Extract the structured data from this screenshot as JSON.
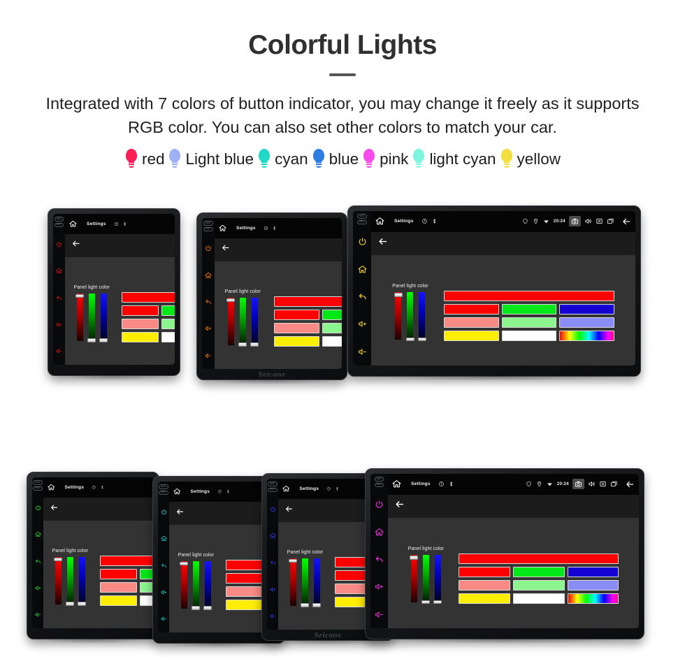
{
  "header": {
    "title": "Colorful Lights",
    "subtitle": "Integrated with 7 colors of button indicator, you may change it freely as it supports RGB color. You can also set other colors to match your car."
  },
  "legend": {
    "items": [
      {
        "label": "red",
        "color": "#fa1d56"
      },
      {
        "label": "Light blue",
        "color": "#9fb0f5"
      },
      {
        "label": "cyan",
        "color": "#24d8c8"
      },
      {
        "label": "blue",
        "color": "#2e7de0"
      },
      {
        "label": "pink",
        "color": "#f94cec"
      },
      {
        "label": "light cyan",
        "color": "#7df5de"
      },
      {
        "label": "yellow",
        "color": "#f2de3e"
      }
    ]
  },
  "device_ui": {
    "status_bar": {
      "home_icon": "home-icon",
      "title": "Settings",
      "mini_icons": [
        "clock-icon",
        "bluetooth-icon"
      ],
      "tray_icons": [
        "shield-icon",
        "location-pin-icon",
        "wifi-icon"
      ],
      "clock": "20:24",
      "action_icons": [
        "camera-icon",
        "volume-icon",
        "close-box-icon",
        "recents-icon",
        "back-arrow-icon"
      ]
    },
    "action_bar": {
      "back_icon": "back-arrow-icon"
    },
    "panel": {
      "label": "Panel light color",
      "sliders": [
        {
          "name": "red",
          "channel": "R",
          "value": 255,
          "thumb": "top"
        },
        {
          "name": "green",
          "channel": "G",
          "value": 0,
          "thumb": "bottom"
        },
        {
          "name": "blue",
          "channel": "B",
          "value": 0,
          "thumb": "bottom"
        }
      ],
      "preview_color": "#ff0000",
      "swatch_rows": [
        [
          "#ff0000",
          "#00e817",
          "#1400d2"
        ],
        [
          "#fa8a85",
          "#8df58d",
          "#8a8df5"
        ],
        [
          "#ffee00",
          "#ffffff",
          "rainbow"
        ]
      ]
    },
    "hardware_buttons": {
      "labels": [
        "MIC",
        "RST"
      ],
      "icons": [
        "power-icon",
        "home-icon",
        "back-icon",
        "volume-up-icon",
        "volume-down-icon"
      ]
    },
    "brand": "Seicane"
  },
  "devices": {
    "top_row": [
      {
        "name": "device-red",
        "button_color": "#e81212"
      },
      {
        "name": "device-orange",
        "button_color": "#f07a10"
      },
      {
        "name": "device-yellow",
        "button_color": "#f2d21a"
      }
    ],
    "bottom_row": [
      {
        "name": "device-green",
        "button_color": "#18e032"
      },
      {
        "name": "device-cyan",
        "button_color": "#12d8d8"
      },
      {
        "name": "device-blue",
        "button_color": "#2a3cf0"
      },
      {
        "name": "device-magenta",
        "button_color": "#ee2ce0"
      }
    ]
  }
}
